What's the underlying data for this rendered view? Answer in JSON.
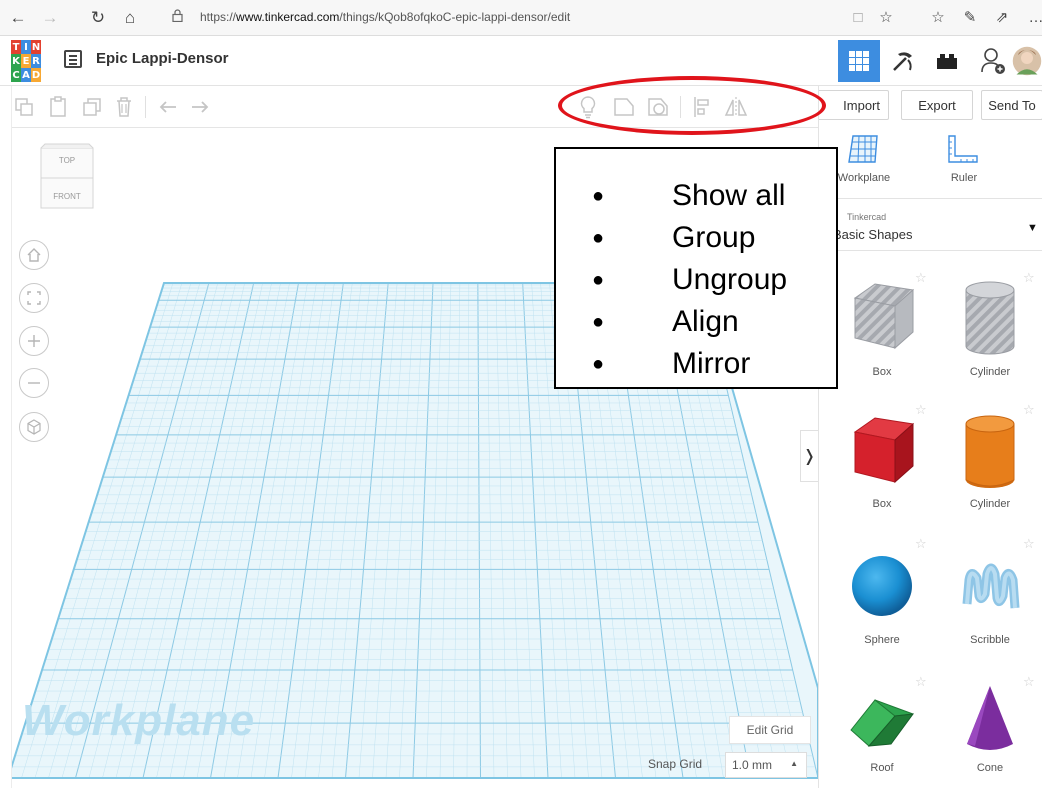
{
  "browser": {
    "url_prefix": "https://",
    "url_host": "www.tinkercad.com",
    "url_path": "/things/kQob8ofqkoC-epic-lappi-densor/edit",
    "nav": {
      "back": "←",
      "forward": "→",
      "refresh": "↻",
      "home": "⌂"
    },
    "right_icons": {
      "reading": "□",
      "favorite": "☆",
      "favorites_bar": "☆",
      "pen": "✎",
      "share": "⇗",
      "more": "…"
    }
  },
  "app": {
    "logo_letters": [
      "T",
      "I",
      "N",
      "K",
      "E",
      "R",
      "C",
      "A",
      "D"
    ],
    "logo_colors": [
      "#e3412f",
      "#3d8de0",
      "#e3412f",
      "#2da44e",
      "#f7a833",
      "#3d8de0",
      "#2da44e",
      "#3d8de0",
      "#f7a833"
    ],
    "design_title": "Epic Lappi-Densor"
  },
  "toolbar": {
    "copy": "⧉",
    "paste": "📋",
    "duplicate": "❐",
    "delete": "🗑",
    "undo": "←",
    "redo": "→",
    "show_all": "💡",
    "group": "⬠",
    "ungroup": "⬠",
    "align": "▤",
    "mirror": "◭"
  },
  "right_panel": {
    "import_label": "Import",
    "export_label": "Export",
    "send_to_label": "Send To",
    "workplane_label": "Workplane",
    "ruler_label": "Ruler",
    "library_source": "Tinkercad",
    "library_name": "Basic Shapes",
    "shapes": [
      {
        "label": "Box",
        "color": "#b4b6bc"
      },
      {
        "label": "Cylinder",
        "color": "#c2c6cc"
      },
      {
        "label": "Box",
        "color": "#d5212c"
      },
      {
        "label": "Cylinder",
        "color": "#e77e1b"
      },
      {
        "label": "Sphere",
        "color": "#1a8fd2"
      },
      {
        "label": "Scribble",
        "color": "#8ec5e6"
      },
      {
        "label": "Roof",
        "color": "#2da44e"
      },
      {
        "label": "Cone",
        "color": "#7b2d9e"
      }
    ]
  },
  "canvas": {
    "viewcube_top": "TOP",
    "viewcube_front": "FRONT",
    "watermark": "Workplane",
    "edit_grid_label": "Edit Grid",
    "snap_grid_label": "Snap Grid",
    "snap_grid_value": "1.0 mm",
    "collapse_arrow": "❭"
  },
  "annotation": {
    "items": [
      "Show all",
      "Group",
      "Ungroup",
      "Align",
      "Mirror"
    ]
  }
}
